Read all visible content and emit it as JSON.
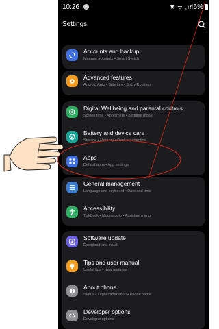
{
  "status": {
    "time": "10:26",
    "icons": "✖ ᯤ ,ıl",
    "battery": "46%"
  },
  "header": {
    "title": "Settings"
  },
  "groups": [
    [
      {
        "title": "Accounts and backup",
        "subtitle": "Manage accounts • Smart Switch",
        "icon": "sync-icon",
        "color": "#3f6fe0"
      }
    ],
    [
      {
        "title": "Advanced features",
        "subtitle": "Android Auto • Side key • Bixby Routines",
        "icon": "star-icon",
        "color": "#f39c1f"
      }
    ],
    [
      {
        "title": "Digital Wellbeing and parental controls",
        "subtitle": "Screen time • App timers • Bedtime mode",
        "icon": "wellbeing-icon",
        "color": "#2eae63"
      },
      {
        "title": "Battery and device care",
        "subtitle": "Storage • Memory • Device protection",
        "icon": "device-care-icon",
        "color": "#18a89a"
      },
      {
        "title": "Apps",
        "subtitle": "Default apps • App settings",
        "icon": "apps-icon",
        "color": "#3f6fe0"
      }
    ],
    [
      {
        "title": "General management",
        "subtitle": "Language and keyboard • Date and time",
        "icon": "general-management-icon",
        "color": "#3a7bd0"
      },
      {
        "title": "Accessibility",
        "subtitle": "TalkBack • Mono audio • Assistant menu",
        "icon": "accessibility-icon",
        "color": "#2eae63"
      }
    ],
    [
      {
        "title": "Software update",
        "subtitle": "Download and install",
        "icon": "software-update-icon",
        "color": "#6a5ee0"
      },
      {
        "title": "Tips and user manual",
        "subtitle": "Useful tips • New features",
        "icon": "tips-icon",
        "color": "#f39c1f"
      },
      {
        "title": "About phone",
        "subtitle": "Status • Legal information • Phone name",
        "icon": "info-icon",
        "color": "#8e8e93"
      },
      {
        "title": "Developer options",
        "subtitle": "Developer options",
        "icon": "developer-options-icon",
        "color": "#8e8e93"
      }
    ]
  ],
  "annotation": {
    "highlighted_item": "Apps",
    "ellipse_color": "#d9261c",
    "arrow_color": "#d9261c",
    "pointer": "hand-pointer-icon"
  }
}
